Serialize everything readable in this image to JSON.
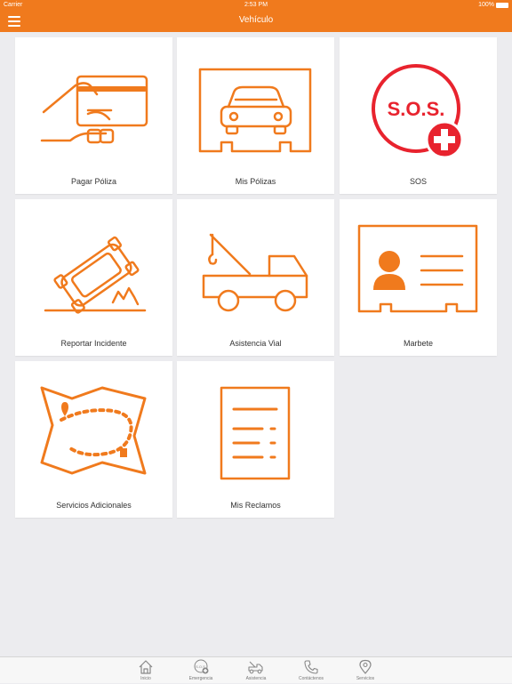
{
  "status_bar": {
    "carrier": "Carrier",
    "time": "2:53 PM",
    "battery": "100%"
  },
  "nav": {
    "title": "Vehículo"
  },
  "tiles": [
    {
      "label": "Pagar Póliza",
      "icon": "card-payment-icon"
    },
    {
      "label": "Mis Pólizas",
      "icon": "car-policy-icon"
    },
    {
      "label": "SOS",
      "icon": "sos-icon",
      "icon_text": "S.O.S."
    },
    {
      "label": "Reportar Incidente",
      "icon": "crash-icon"
    },
    {
      "label": "Asistencia Vial",
      "icon": "tow-truck-icon"
    },
    {
      "label": "Marbete",
      "icon": "id-card-icon"
    },
    {
      "label": "Servicios Adicionales",
      "icon": "map-icon"
    },
    {
      "label": "Mis Reclamos",
      "icon": "document-icon"
    }
  ],
  "tabs": [
    {
      "label": "Inicio",
      "icon": "home-icon"
    },
    {
      "label": "Emergencia",
      "icon": "sos-icon",
      "icon_text": "S.O.S."
    },
    {
      "label": "Asistencia",
      "icon": "tow-truck-icon"
    },
    {
      "label": "Contáctenos",
      "icon": "phone-icon"
    },
    {
      "label": "Servicios",
      "icon": "location-pin-icon"
    }
  ],
  "colors": {
    "brand": "#f07a1d",
    "sos_red": "#e8232e",
    "background": "#ececef"
  }
}
